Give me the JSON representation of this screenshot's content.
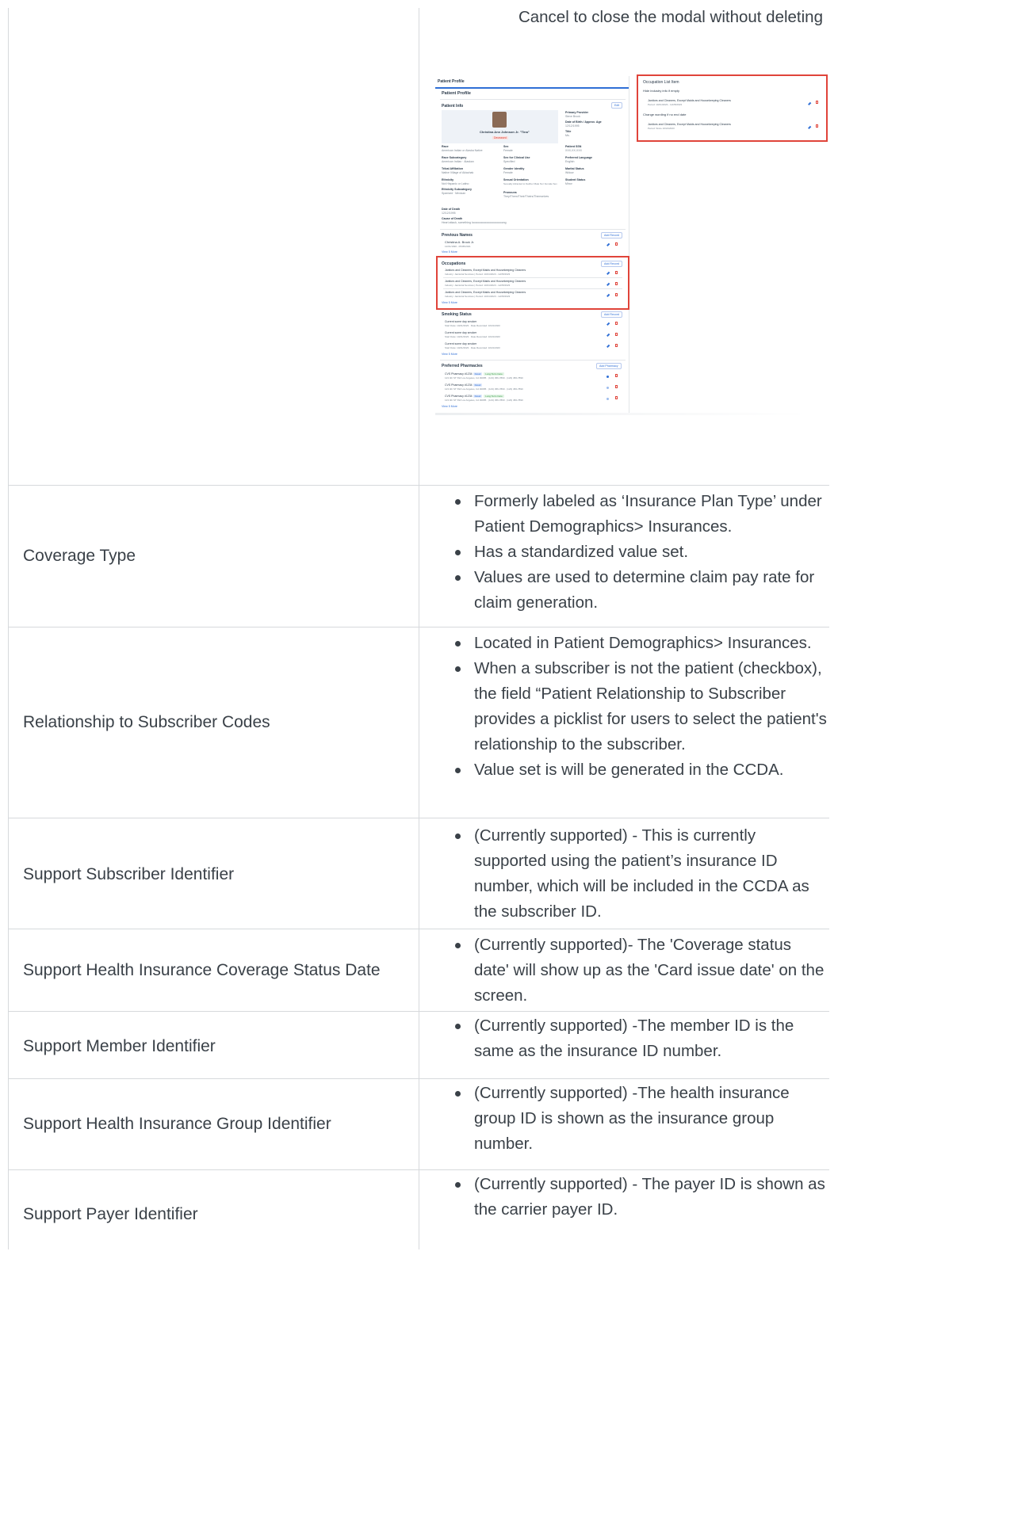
{
  "top_note": "Cancel to close the modal without deleting",
  "screenshot": {
    "header": "Patient Profile",
    "subheader": "Patient Profile",
    "patient_info_title": "Patient Info",
    "edit_label": "Edit",
    "patient_name": "Christina Ann Johnson Jr. \"Tina\"",
    "deceased_badge": "Deceased",
    "right_fields": [
      {
        "label": "Primary Provider",
        "value": "Steve Brock"
      },
      {
        "label": "Date of Birth / Approx. Age",
        "value": "12/12/1995"
      },
      {
        "label": "Title",
        "value": "Ms."
      }
    ],
    "col1": [
      {
        "label": "Race",
        "value": "American Indian or Alaska Native"
      },
      {
        "label": "Race Subcategory",
        "value": "American Indian · Alaskan"
      },
      {
        "label": "Tribal Affiliation",
        "value": "Native Village of Akiachak"
      },
      {
        "label": "Ethnicity",
        "value": "Not Hispanic or Latino"
      },
      {
        "label": "Ethnicity Subcategory",
        "value": "Spaniard · Mexican"
      }
    ],
    "col2": [
      {
        "label": "Sex",
        "value": "Female"
      },
      {
        "label": "Sex for Clinical Use",
        "value": "Specified"
      },
      {
        "label": "Gender Identity",
        "value": "Female"
      },
      {
        "label": "Sexual Orientation",
        "value": "Sexually Attracted to Neither Male Nor Female Sex"
      },
      {
        "label": "Pronouns",
        "value": "They/Them/Their/Theirs/Themselves"
      }
    ],
    "col3": [
      {
        "label": "Patient SSN",
        "value": "XXX-XX-XXX"
      },
      {
        "label": "Preferred Language",
        "value": "English"
      },
      {
        "label": "Marital Status",
        "value": "Widow"
      },
      {
        "label": "Student Status",
        "value": "Minor"
      }
    ],
    "death": [
      {
        "label": "Date of Death",
        "value": "12/12/1995"
      },
      {
        "label": "Cause of Death",
        "value": "Heart attack, something loooooooooooooooooooong"
      }
    ],
    "previous_names_title": "Previous Names",
    "add_record": "Add Record",
    "previous_name": "Christina A. Brock Jr.",
    "previous_name_sub": "12/01/1990 - 05/05/2021",
    "view_more": "View 5 More",
    "occupations_title": "Occupations",
    "occupation_item": "Janitors and Cleaners, Except Maids and Housekeeping Cleaners",
    "occupation_sub": "Industry: Janitorial Services | Period: 10/21/2023 - 12/25/2023",
    "smoking_title": "Smoking Status",
    "smoking_item": "Current some day smoker",
    "smoking_sub": "Start Date: 10/21/2023 · Date Recorded: 10/21/2023",
    "pharm_title": "Preferred Pharmacies",
    "add_pharmacy": "Add Pharmacy",
    "pharm_item": "CVS Pharmacy #1234",
    "pharm_tag1": "Retail",
    "pharm_tag2": "Long Term Care",
    "pharm_sub": "123 4th ST SW Los Angeles, CA 90085 · (123) 456-7890 · (123) 456-7890",
    "occ_panel": {
      "title": "Occupation List Item",
      "sub1": "Hide industry info if empty",
      "item1": "Janitors and Cleaners, Except Maids and Housekeeping Cleaners",
      "item1_sub": "Period: 10/21/2023 - 12/25/2023",
      "sub2": "Change wording if no end date",
      "item2": "Janitors and Cleaners, Except Maids and Housekeeping Cleaners",
      "item2_sub": "Period: Since 10/21/2023"
    }
  },
  "rows": [
    {
      "label": "Coverage Type",
      "bullets": [
        "Formerly labeled as  ‘Insurance Plan Type’ under Patient Demographics> Insurances.",
        " Has a  standardized value set.",
        "Values are used to determine claim pay rate for claim generation."
      ]
    },
    {
      "label": "Relationship to Subscriber Codes",
      "bullets": [
        "Located in Patient Demographics> Insurances.",
        " When a subscriber is not the patient (checkbox), the field “Patient Relationship to Subscriber provides a picklist for users to select the patient's relationship to the subscriber.",
        "Value set is will be generated in the CCDA."
      ]
    },
    {
      "label": "Support Subscriber Identifier",
      "bullets": [
        "(Currently supported) - This is currently supported using the patient’s insurance ID number, which will be included in the CCDA as the subscriber ID."
      ]
    },
    {
      "label": "Support Health Insurance Coverage Status Date",
      "bullets": [
        "(Currently supported)- The 'Coverage status date' will show up as the 'Card issue date' on the screen."
      ]
    },
    {
      "label": "Support Member Identifier",
      "bullets": [
        "(Currently supported) -The member ID is the same as the insurance ID number."
      ]
    },
    {
      "label": "Support Health Insurance Group Identifier",
      "bullets": [
        "(Currently supported) -The health insurance group ID is shown as the insurance group number."
      ]
    },
    {
      "label": "Support Payer Identifier",
      "bullets": [
        "(Currently supported) - The payer ID is shown as the carrier payer ID."
      ]
    }
  ]
}
